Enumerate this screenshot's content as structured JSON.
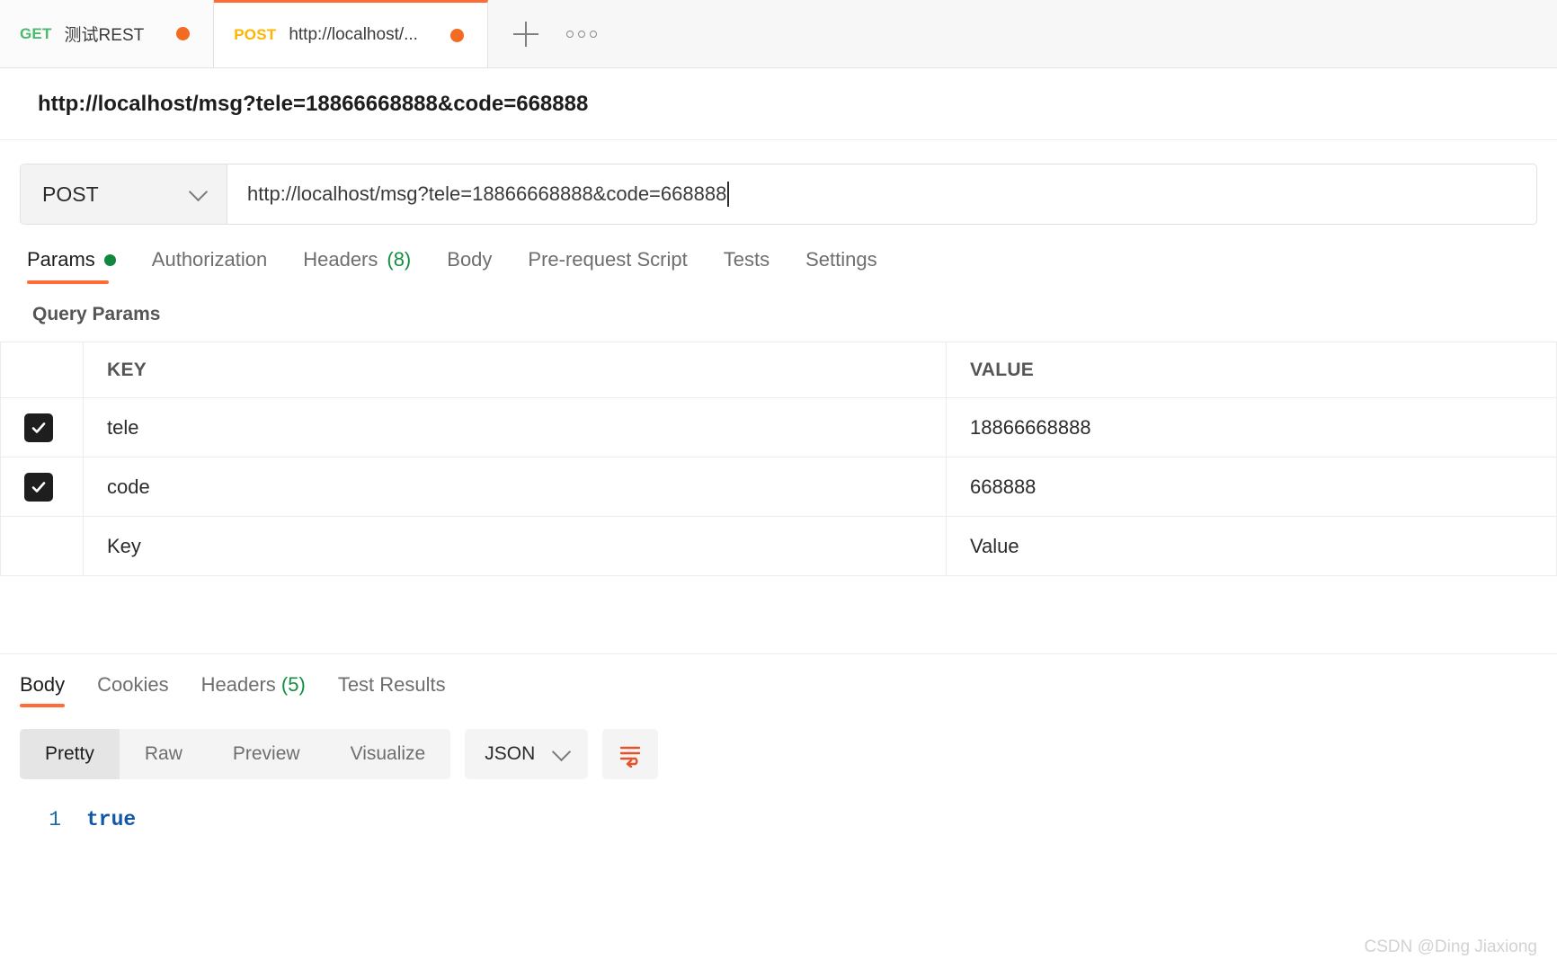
{
  "tabstrip": {
    "tabs": [
      {
        "method": "GET",
        "title": "测试REST",
        "unsaved": true,
        "active": false
      },
      {
        "method": "POST",
        "title": "http://localhost/...",
        "unsaved": true,
        "active": true
      }
    ],
    "add_tab_icon": "plus-icon",
    "more_options_icon": "ellipsis-icon"
  },
  "request": {
    "title": "http://localhost/msg?tele=18866668888&code=668888",
    "method": "POST",
    "url": "http://localhost/msg?tele=18866668888&code=668888",
    "method_chevron_icon": "chevron-down-icon",
    "tabs": [
      {
        "label": "Params",
        "badge": "",
        "dot": true,
        "active": true
      },
      {
        "label": "Authorization",
        "badge": "",
        "dot": false,
        "active": false
      },
      {
        "label": "Headers",
        "badge": "(8)",
        "dot": false,
        "active": false
      },
      {
        "label": "Body",
        "badge": "",
        "dot": false,
        "active": false
      },
      {
        "label": "Pre-request Script",
        "badge": "",
        "dot": false,
        "active": false
      },
      {
        "label": "Tests",
        "badge": "",
        "dot": false,
        "active": false
      },
      {
        "label": "Settings",
        "badge": "",
        "dot": false,
        "active": false
      }
    ]
  },
  "query_params": {
    "section_title": "Query Params",
    "columns": {
      "key": "KEY",
      "value": "VALUE"
    },
    "rows": [
      {
        "checked": true,
        "key": "tele",
        "value": "18866668888"
      },
      {
        "checked": true,
        "key": "code",
        "value": "668888"
      }
    ],
    "placeholder_row": {
      "key": "Key",
      "value": "Value"
    }
  },
  "response": {
    "tabs": [
      {
        "label": "Body",
        "badge": "",
        "active": true
      },
      {
        "label": "Cookies",
        "badge": "",
        "active": false
      },
      {
        "label": "Headers",
        "badge": "(5)",
        "active": false
      },
      {
        "label": "Test Results",
        "badge": "",
        "active": false
      }
    ],
    "format_options": [
      {
        "label": "Pretty",
        "active": true
      },
      {
        "label": "Raw",
        "active": false
      },
      {
        "label": "Preview",
        "active": false
      },
      {
        "label": "Visualize",
        "active": false
      }
    ],
    "language": "JSON",
    "language_chevron_icon": "chevron-down-icon",
    "wrap_lines_icon": "wrap-lines-icon",
    "body": {
      "lines": [
        {
          "number": "1",
          "text": "true"
        }
      ]
    }
  },
  "watermark": "CSDN @Ding Jiaxiong",
  "colors": {
    "accent": "#ff6c37",
    "get_method": "#49bc6b",
    "post_method": "#ffb400",
    "unsaved_dot": "#f26b21",
    "badge_green": "#12903f",
    "code_blue": "#1157a8"
  }
}
